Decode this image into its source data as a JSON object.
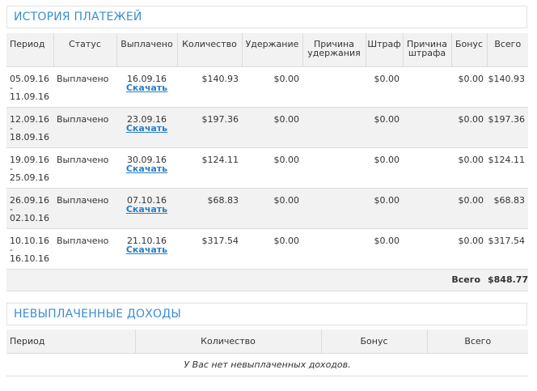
{
  "payment_history": {
    "title": "История платежей",
    "headers": {
      "period": "Период",
      "status": "Статус",
      "paid": "Выплачено",
      "amount": "Количество",
      "deduction": "Удержание",
      "deduction_reason": [
        "Причина",
        "удержания"
      ],
      "penalty": "Штраф",
      "penalty_reason": [
        "Причина",
        "штрафа"
      ],
      "bonus": "Бонус",
      "total": "Всего"
    },
    "rows": [
      {
        "period_start": "05.09.16",
        "period_sep": "-",
        "period_end": "11.09.16",
        "status": "Выплачено",
        "paid_date": "16.09.16",
        "download": "Скачать",
        "amount": "$140.93",
        "deduction": "$0.00",
        "deduction_reason": "",
        "penalty": "$0.00",
        "penalty_reason": "",
        "bonus": "$0.00",
        "total": "$140.93"
      },
      {
        "period_start": "12.09.16",
        "period_sep": "-",
        "period_end": "18.09.16",
        "status": "Выплачено",
        "paid_date": "23.09.16",
        "download": "Скачать",
        "amount": "$197.36",
        "deduction": "$0.00",
        "deduction_reason": "",
        "penalty": "$0.00",
        "penalty_reason": "",
        "bonus": "$0.00",
        "total": "$197.36"
      },
      {
        "period_start": "19.09.16",
        "period_sep": "-",
        "period_end": "25.09.16",
        "status": "Выплачено",
        "paid_date": "30.09.16",
        "download": "Скачать",
        "amount": "$124.11",
        "deduction": "$0.00",
        "deduction_reason": "",
        "penalty": "$0.00",
        "penalty_reason": "",
        "bonus": "$0.00",
        "total": "$124.11"
      },
      {
        "period_start": "26.09.16",
        "period_sep": "-",
        "period_end": "02.10.16",
        "status": "Выплачено",
        "paid_date": "07.10.16",
        "download": "Скачать",
        "amount": "$68.83",
        "deduction": "$0.00",
        "deduction_reason": "",
        "penalty": "$0.00",
        "penalty_reason": "",
        "bonus": "$0.00",
        "total": "$68.83"
      },
      {
        "period_start": "10.10.16",
        "period_sep": "-",
        "period_end": "16.10.16",
        "status": "Выплачено",
        "paid_date": "21.10.16",
        "download": "Скачать",
        "amount": "$317.54",
        "deduction": "$0.00",
        "deduction_reason": "",
        "penalty": "$0.00",
        "penalty_reason": "",
        "bonus": "$0.00",
        "total": "$317.54"
      }
    ],
    "grand_total_label": "Всего",
    "grand_total_value": "$848.77"
  },
  "unpaid_income": {
    "title": "Невыплаченные доходы",
    "headers": {
      "period": "Период",
      "amount": "Количество",
      "bonus": "Бонус",
      "total": "Всего"
    },
    "empty_message": "У Вас нет невыплаченных доходов."
  },
  "colors": {
    "accent": "#3a8fd0",
    "link": "#2a7fc4",
    "row_alt": "#f2f2f2",
    "border": "#dcdcdc"
  }
}
